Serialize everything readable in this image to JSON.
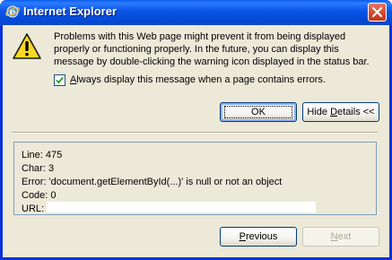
{
  "window": {
    "title": "Internet Explorer",
    "title_icon": "ie-logo-icon",
    "close_icon": "close-icon"
  },
  "message": {
    "icon": "warning-icon",
    "text": "Problems with this Web page might prevent it from being displayed properly or functioning properly. In the future, you can display this message by double-clicking the warning icon displayed in the status bar."
  },
  "checkbox": {
    "checked": true,
    "label_prefix": "",
    "label_underlined": "A",
    "label_rest": "lways display this message when a page contains errors."
  },
  "buttons": {
    "ok_label": "OK",
    "hide_details_underlined": "D",
    "hide_details_prefix": "Hide ",
    "hide_details_rest": "etails <<",
    "previous_underlined": "P",
    "previous_rest": "revious",
    "next_underlined": "N",
    "next_rest": "ext"
  },
  "details": {
    "line": "Line:  475",
    "char": "Char:  3",
    "error": "Error:  'document.getElementById(...)' is null or not an object",
    "code": "Code: 0",
    "url": "URL:"
  },
  "colors": {
    "titlebar": "#0a54e6",
    "dialog_bg": "#ece9d8",
    "close_button": "#d4452a",
    "warning_yellow": "#f8d820"
  }
}
